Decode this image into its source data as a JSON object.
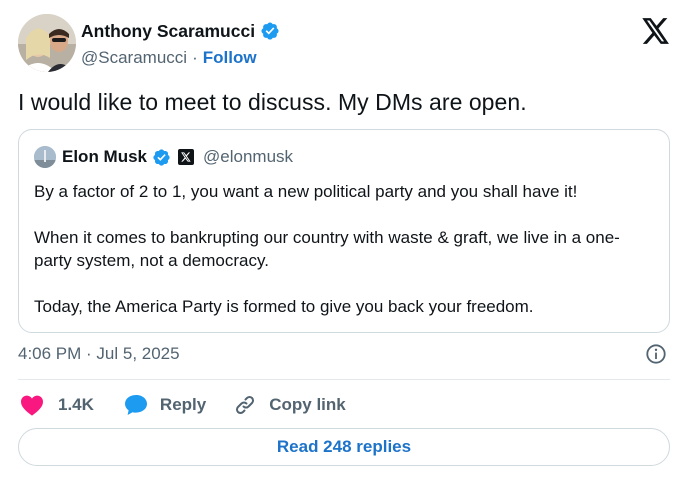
{
  "author": {
    "name": "Anthony Scaramucci",
    "handle": "@Scaramucci",
    "separator": "·",
    "follow_label": "Follow"
  },
  "tweet": {
    "text": "I would like to meet to discuss. My DMs are open."
  },
  "quoted": {
    "name": "Elon Musk",
    "handle": "@elonmusk",
    "paragraphs": [
      "By a factor of 2 to 1, you want a new political party and you shall have it!",
      "When it comes to bankrupting our country with waste & graft, we live in a one-party system, not a democracy.",
      "Today, the America Party is formed to give you back your freedom."
    ]
  },
  "meta": {
    "timestamp": "4:06 PM · Jul 5, 2025"
  },
  "actions": {
    "like_count": "1.4K",
    "reply_label": "Reply",
    "copy_label": "Copy link"
  },
  "read_replies_label": "Read 248 replies",
  "colors": {
    "verified": "#1d9bf0",
    "link": "#1d73c9",
    "like": "#f91880",
    "reply": "#1d9bf0",
    "text": "#0f1419",
    "muted": "#536471",
    "border": "#cfd9de"
  },
  "icons": {
    "brand": "x-logo-icon",
    "verified": "verified-badge-icon",
    "info": "info-icon",
    "like": "heart-icon",
    "reply": "speech-bubble-icon",
    "copy": "link-icon"
  }
}
